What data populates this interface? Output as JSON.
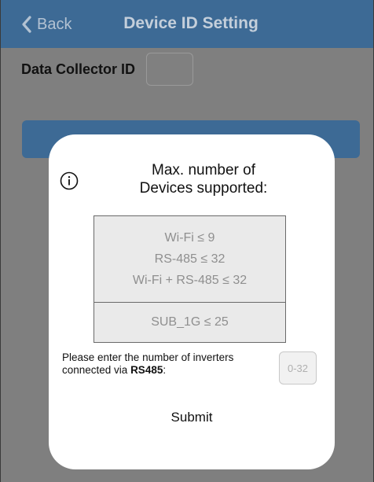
{
  "header": {
    "back_label": "Back",
    "title": "Device ID Setting"
  },
  "collector": {
    "label": "Data Collector ID",
    "value": ""
  },
  "modal": {
    "info_icon": "info-circle-icon",
    "title_line1": "Max. number of",
    "title_line2": "Devices supported:",
    "limits": {
      "wifi": "Wi-Fi ≤ 9",
      "rs485": "RS-485 ≤ 32",
      "combined": "Wi-Fi + RS-485 ≤ 32",
      "sub1g": "SUB_1G ≤ 25"
    },
    "prompt_prefix": "Please enter the number of inverters connected via ",
    "prompt_bold": "RS485",
    "prompt_suffix": ":",
    "input_placeholder": "0-32",
    "input_value": "",
    "submit_label": "Submit"
  },
  "colors": {
    "header_bg": "#3d6a95",
    "overlay_bg": "#7f7f7f",
    "modal_bg": "#ffffff"
  }
}
